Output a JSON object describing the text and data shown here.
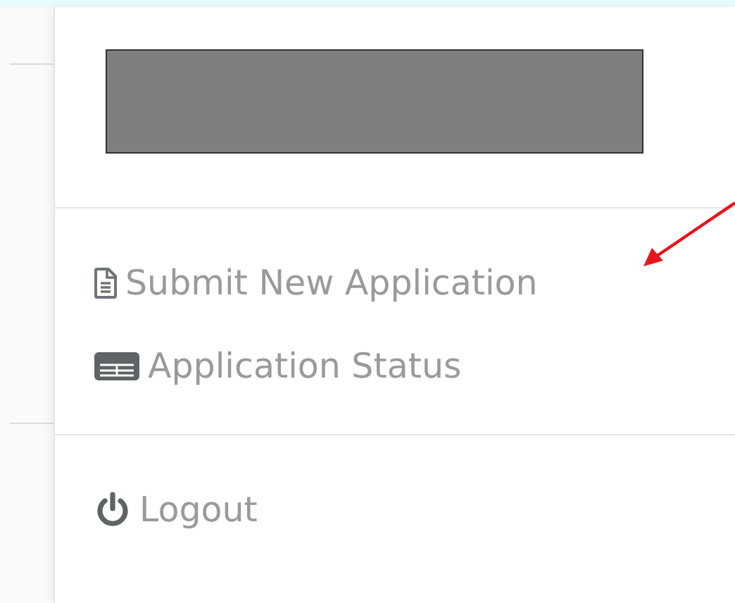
{
  "menu": {
    "sections": [
      {
        "items": [
          {
            "kind": "document",
            "label": "Submit New Application"
          },
          {
            "kind": "table",
            "label": "Application Status"
          }
        ]
      },
      {
        "items": [
          {
            "kind": "power",
            "label": "Logout"
          }
        ]
      }
    ]
  }
}
